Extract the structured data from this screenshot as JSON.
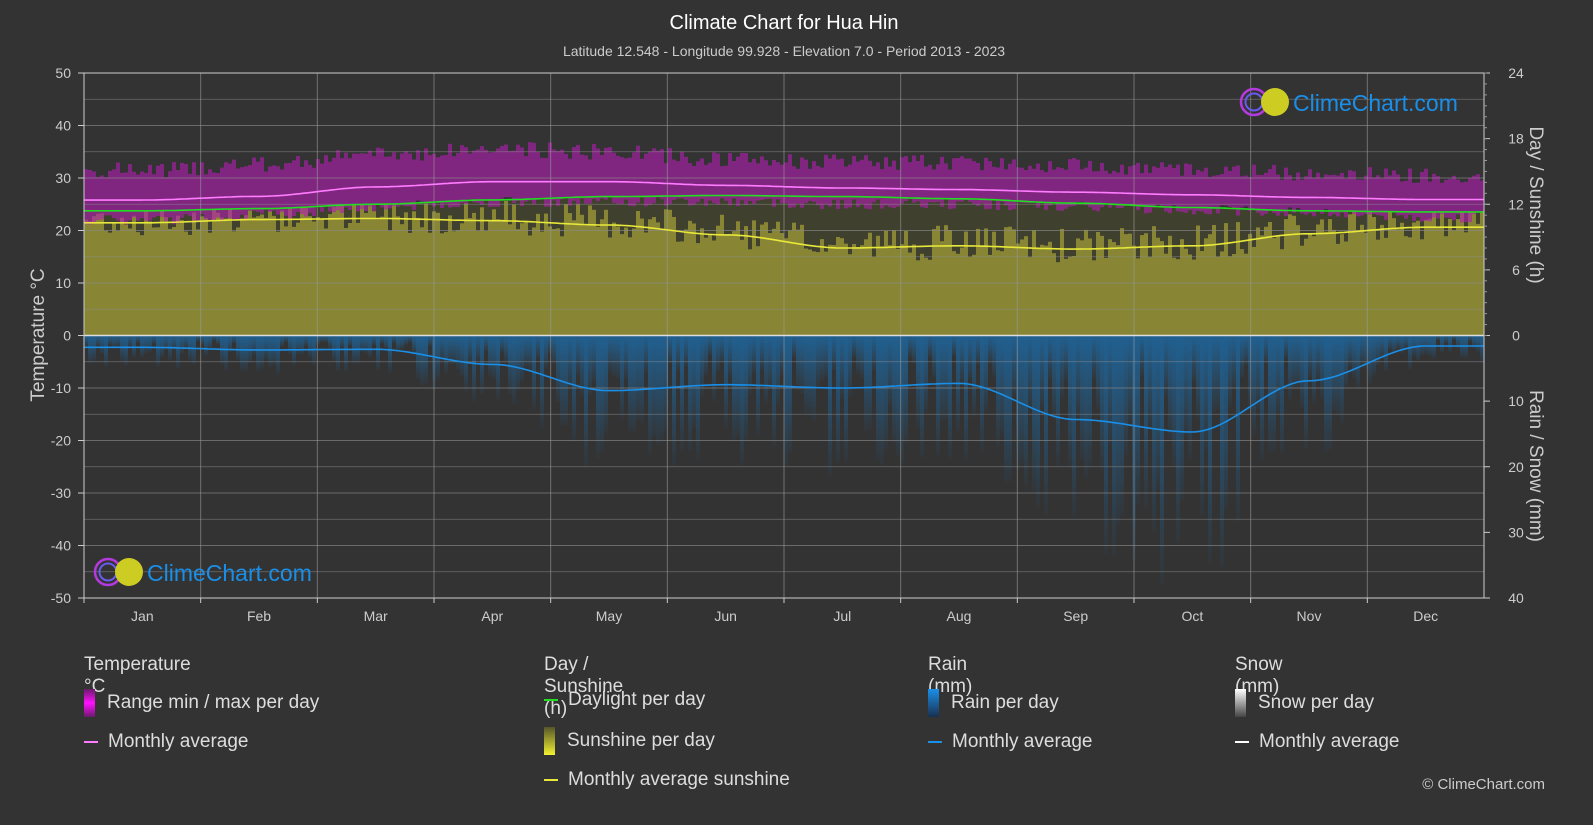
{
  "chart_data": {
    "type": "area",
    "title": "Climate Chart for Hua Hin",
    "subtitle": "Latitude 12.548 - Longitude 99.928 - Elevation 7.0 - Period 2013 - 2023",
    "categories": [
      "Jan",
      "Feb",
      "Mar",
      "Apr",
      "May",
      "Jun",
      "Jul",
      "Aug",
      "Sep",
      "Oct",
      "Nov",
      "Dec"
    ],
    "left_axis": {
      "label": "Temperature °C",
      "range": [
        -50,
        50
      ],
      "ticks": [
        "50",
        "40",
        "30",
        "20",
        "10",
        "0",
        "-10",
        "-20",
        "-30",
        "-40",
        "-50"
      ]
    },
    "right_axis_top": {
      "label": "Day / Sunshine (h)",
      "range": [
        0,
        24
      ],
      "ticks": [
        "24",
        "18",
        "12",
        "6",
        "0"
      ]
    },
    "right_axis_bottom": {
      "label": "Rain / Snow (mm)",
      "range": [
        0,
        40
      ],
      "ticks": [
        "0",
        "10",
        "20",
        "30",
        "40"
      ]
    },
    "grid": true,
    "series": [
      {
        "name": "Temperature monthly average",
        "unit": "°C",
        "color": "#ff7bff",
        "values": [
          25.8,
          26.5,
          28.3,
          29.3,
          29.3,
          28.6,
          28.1,
          27.8,
          27.3,
          26.8,
          26.3,
          25.9
        ]
      },
      {
        "name": "Temperature range max per day (approx.)",
        "unit": "°C",
        "color": "#c71fc7",
        "values": [
          31.5,
          32.5,
          34.5,
          35.5,
          35.0,
          33.5,
          33.0,
          33.0,
          32.5,
          31.5,
          31.0,
          30.5
        ]
      },
      {
        "name": "Temperature range min per day (approx.)",
        "unit": "°C",
        "color": "#c71fc7",
        "values": [
          22.0,
          23.0,
          24.5,
          25.5,
          25.5,
          25.5,
          25.0,
          25.0,
          24.5,
          24.0,
          23.5,
          22.5
        ]
      },
      {
        "name": "Daylight per day",
        "unit": "h",
        "color": "#22dd22",
        "values": [
          11.4,
          11.6,
          12.0,
          12.4,
          12.7,
          12.8,
          12.7,
          12.5,
          12.1,
          11.7,
          11.4,
          11.3
        ]
      },
      {
        "name": "Monthly average sunshine",
        "unit": "h",
        "color": "#e8e83a",
        "values": [
          10.3,
          10.6,
          10.7,
          10.5,
          10.1,
          9.2,
          8.0,
          8.2,
          7.9,
          8.2,
          9.3,
          9.9
        ]
      },
      {
        "name": "Rain monthly average",
        "unit": "mm",
        "color": "#1a8fe8",
        "values": [
          1.8,
          2.2,
          2.1,
          4.4,
          8.4,
          7.5,
          8.0,
          7.3,
          12.8,
          14.7,
          6.9,
          1.6
        ]
      },
      {
        "name": "Snow monthly average",
        "unit": "mm",
        "color": "#ffffff",
        "values": [
          0,
          0,
          0,
          0,
          0,
          0,
          0,
          0,
          0,
          0,
          0,
          0
        ]
      }
    ]
  },
  "watermark": {
    "text": "ClimeChart.com"
  },
  "legend": {
    "groups": [
      {
        "title": "Temperature °C",
        "items": [
          {
            "label": "Range min / max per day",
            "kind": "bar",
            "color": "#e21be2"
          },
          {
            "label": "Monthly average",
            "kind": "line",
            "color": "#ff7bff"
          }
        ]
      },
      {
        "title": "Day / Sunshine (h)",
        "items": [
          {
            "label": "Daylight per day",
            "kind": "line",
            "color": "#22dd22"
          },
          {
            "label": "Sunshine per day",
            "kind": "bar",
            "color": "#e8e83a"
          },
          {
            "label": "Monthly average sunshine",
            "kind": "line",
            "color": "#e8e83a"
          }
        ]
      },
      {
        "title": "Rain (mm)",
        "items": [
          {
            "label": "Rain per day",
            "kind": "bar",
            "color": "#1a8fe8"
          },
          {
            "label": "Monthly average",
            "kind": "line",
            "color": "#1a8fe8"
          }
        ]
      },
      {
        "title": "Snow (mm)",
        "items": [
          {
            "label": "Snow per day",
            "kind": "bar",
            "color": "#dddddd"
          },
          {
            "label": "Monthly average",
            "kind": "line",
            "color": "#ffffff"
          }
        ]
      }
    ]
  },
  "copyright": "© ClimeChart.com"
}
